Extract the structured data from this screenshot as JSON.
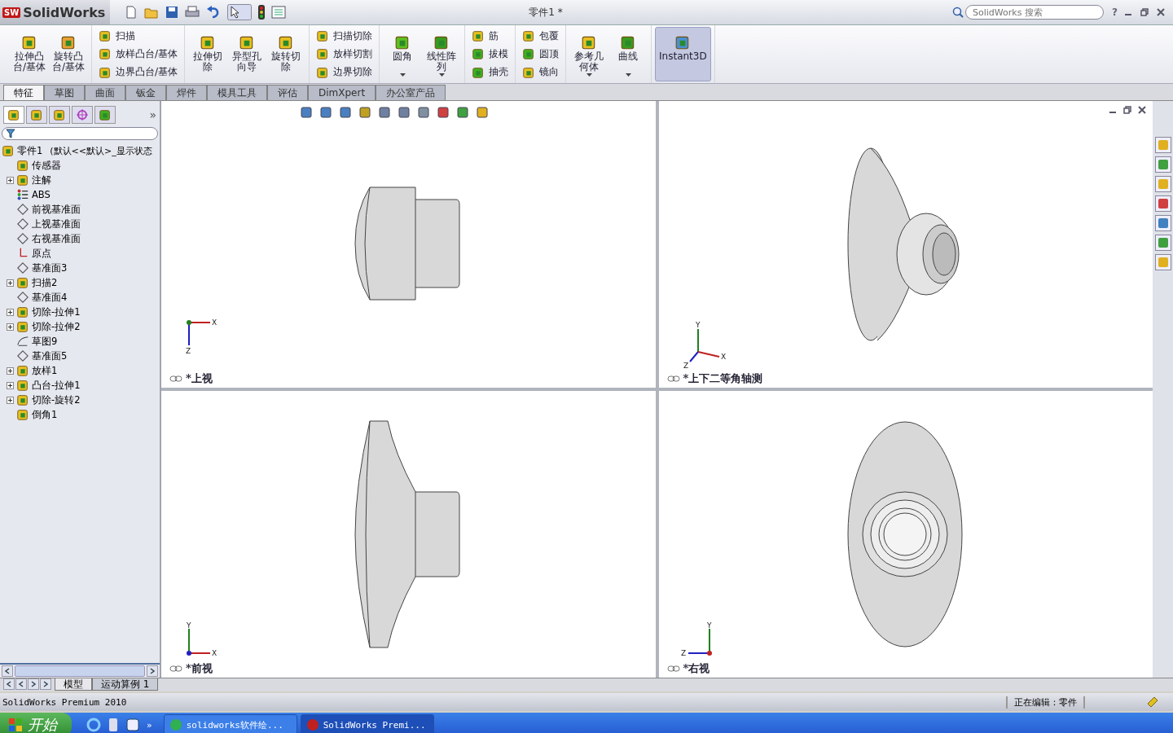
{
  "title_bar": {
    "logo": "SolidWorks",
    "logo_badge": "SW",
    "document_title": "零件1 *",
    "search": {
      "placeholder": "SolidWorks 搜索"
    },
    "help": "?"
  },
  "ribbon": {
    "groups": [
      {
        "kind": "large",
        "items": [
          {
            "label": "拉伸凸台/基体",
            "on": false,
            "dropdown": false
          },
          {
            "label": "旋转凸台/基体",
            "on": false,
            "dropdown": false
          }
        ]
      },
      {
        "kind": "stack",
        "items": [
          {
            "label": "扫描"
          },
          {
            "label": "放样凸台/基体"
          },
          {
            "label": "边界凸台/基体"
          }
        ]
      },
      {
        "kind": "large",
        "items": [
          {
            "label": "拉伸切除",
            "on": false,
            "dropdown": false
          },
          {
            "label": "异型孔向导",
            "on": false,
            "dropdown": false
          },
          {
            "label": "旋转切除",
            "on": false,
            "dropdown": false
          }
        ]
      },
      {
        "kind": "stack",
        "items": [
          {
            "label": "扫描切除"
          },
          {
            "label": "放样切割"
          },
          {
            "label": "边界切除"
          }
        ]
      },
      {
        "kind": "large",
        "items": [
          {
            "label": "圆角",
            "on": false,
            "dropdown": true
          },
          {
            "label": "线性阵列",
            "on": false,
            "dropdown": true
          }
        ]
      },
      {
        "kind": "stack",
        "items": [
          {
            "label": "筋"
          },
          {
            "label": "拔模"
          },
          {
            "label": "抽壳"
          }
        ]
      },
      {
        "kind": "stack",
        "items": [
          {
            "label": "包覆"
          },
          {
            "label": "圆顶"
          },
          {
            "label": "镜向"
          }
        ]
      },
      {
        "kind": "large",
        "items": [
          {
            "label": "参考几何体",
            "on": false,
            "dropdown": true
          },
          {
            "label": "曲线",
            "on": false,
            "dropdown": true
          }
        ]
      },
      {
        "kind": "large",
        "items": [
          {
            "label": "Instant3D",
            "on": true,
            "dropdown": false
          }
        ]
      }
    ]
  },
  "command_tabs": [
    {
      "label": "特征",
      "selected": true
    },
    {
      "label": "草图",
      "selected": false
    },
    {
      "label": "曲面",
      "selected": false
    },
    {
      "label": "钣金",
      "selected": false
    },
    {
      "label": "焊件",
      "selected": false
    },
    {
      "label": "模具工具",
      "selected": false
    },
    {
      "label": "评估",
      "selected": false
    },
    {
      "label": "DimXpert",
      "selected": false
    },
    {
      "label": "办公室产品",
      "selected": false
    }
  ],
  "feature_manager": {
    "more": "»",
    "tree": {
      "label": "零件1",
      "description": "(默认<<默认>_显示状态",
      "children": [
        {
          "label": "传感器",
          "expandable": false
        },
        {
          "label": "注解",
          "expandable": true
        },
        {
          "label": "ABS",
          "expandable": false
        },
        {
          "label": "前视基准面",
          "expandable": false
        },
        {
          "label": "上视基准面",
          "expandable": false
        },
        {
          "label": "右视基准面",
          "expandable": false
        },
        {
          "label": "原点",
          "expandable": false
        },
        {
          "label": "基准面3",
          "expandable": false
        },
        {
          "label": "扫描2",
          "expandable": true
        },
        {
          "label": "基准面4",
          "expandable": false
        },
        {
          "label": "切除-拉伸1",
          "expandable": true
        },
        {
          "label": "切除-拉伸2",
          "expandable": true
        },
        {
          "label": "草图9",
          "expandable": false
        },
        {
          "label": "基准面5",
          "expandable": false
        },
        {
          "label": "放样1",
          "expandable": true
        },
        {
          "label": "凸台-拉伸1",
          "expandable": true
        },
        {
          "label": "切除-旋转2",
          "expandable": true
        },
        {
          "label": "倒角1",
          "expandable": false
        }
      ]
    }
  },
  "viewports": [
    {
      "kind": "top",
      "label": "*上视",
      "axes": [
        "X",
        "Z"
      ]
    },
    {
      "kind": "iso",
      "label": "*上下二等角轴测",
      "axes": [
        "Y",
        "X",
        "Z"
      ]
    },
    {
      "kind": "front",
      "label": "*前视",
      "axes": [
        "Y",
        "X"
      ]
    },
    {
      "kind": "right",
      "label": "*右视",
      "axes": [
        "Y",
        "Z"
      ]
    }
  ],
  "bottom_tabs": [
    {
      "label": "模型",
      "selected": true
    },
    {
      "label": "运动算例 1",
      "selected": false
    }
  ],
  "status_bar": {
    "product": "SolidWorks Premium 2010",
    "editing": "正在编辑：零件"
  },
  "taskbar": {
    "start": "开始",
    "more": "»",
    "tasks": [
      {
        "label": "solidworks软件绘...",
        "selected": false
      },
      {
        "label": "SolidWorks Premi...",
        "selected": true
      }
    ]
  }
}
